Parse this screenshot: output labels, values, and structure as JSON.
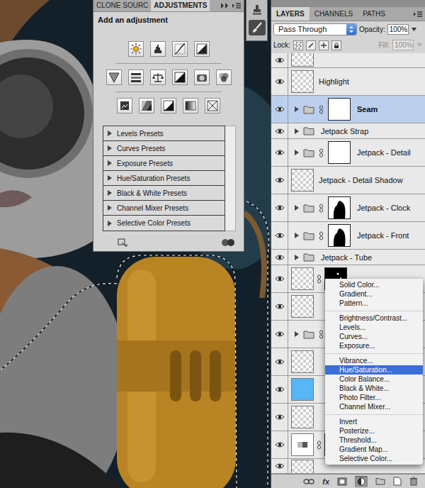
{
  "adjustments_panel": {
    "tabs": [
      {
        "label": "CLONE SOURC",
        "selected": false
      },
      {
        "label": "ADJUSTMENTS",
        "selected": true
      }
    ],
    "heading": "Add an adjustment",
    "presets": [
      {
        "label": "Levels Presets",
        "expanded": false
      },
      {
        "label": "Curves Presets",
        "expanded": false
      },
      {
        "label": "Exposure Presets",
        "expanded": false
      },
      {
        "label": "Hue/Saturation Presets",
        "expanded": false
      },
      {
        "label": "Black & White Presets",
        "expanded": false
      },
      {
        "label": "Channel Mixer Presets",
        "expanded": false
      },
      {
        "label": "Selective Color Presets",
        "expanded": false
      }
    ]
  },
  "layers_panel": {
    "tabs": [
      {
        "label": "LAYERS",
        "selected": true
      },
      {
        "label": "CHANNELS",
        "selected": false
      },
      {
        "label": "PATHS",
        "selected": false
      }
    ],
    "blend_mode": "Pass Through",
    "opacity_label": "Opacity:",
    "opacity": "100%",
    "lock_label": "Lock:",
    "fill_label": "Fill:",
    "fill": "100%",
    "fill_disabled": true,
    "layers": [
      {
        "name": "",
        "kind": "layer",
        "visible": true,
        "selected": false,
        "expanded": false,
        "mask": "none",
        "partial": true,
        "color": ""
      },
      {
        "name": "Highlight",
        "kind": "layer",
        "visible": true,
        "selected": false,
        "expanded": false,
        "mask": "none",
        "partial": false,
        "color": ""
      },
      {
        "name": "Seam",
        "kind": "group",
        "visible": true,
        "selected": true,
        "expanded": false,
        "mask": "white",
        "partial": false,
        "color": ""
      },
      {
        "name": "Jetpack Strap",
        "kind": "group",
        "visible": true,
        "selected": false,
        "expanded": false,
        "mask": "none",
        "partial": false,
        "color": ""
      },
      {
        "name": "Jetpack - Detail",
        "kind": "group",
        "visible": true,
        "selected": false,
        "expanded": false,
        "mask": "white",
        "partial": false,
        "color": ""
      },
      {
        "name": "Jetpack - Detail Shadow",
        "kind": "layer",
        "visible": true,
        "selected": false,
        "expanded": false,
        "mask": "none",
        "partial": false,
        "color": ""
      },
      {
        "name": "Jetpack - Clock",
        "kind": "group",
        "visible": true,
        "selected": false,
        "expanded": false,
        "mask": "shape",
        "partial": false,
        "color": ""
      },
      {
        "name": "Jetpack - Front",
        "kind": "group",
        "visible": true,
        "selected": false,
        "expanded": false,
        "mask": "shape",
        "partial": false,
        "color": ""
      },
      {
        "name": "Jetpack - Tube",
        "kind": "group",
        "visible": true,
        "selected": false,
        "expanded": false,
        "mask": "none",
        "partial": false,
        "color": ""
      },
      {
        "name": "",
        "kind": "layer",
        "visible": true,
        "selected": false,
        "expanded": false,
        "mask": "dark",
        "partial": false,
        "color": ""
      },
      {
        "name": "",
        "kind": "layer",
        "visible": true,
        "selected": false,
        "expanded": false,
        "mask": "none",
        "partial": false,
        "color": ""
      },
      {
        "name": "",
        "kind": "group",
        "visible": true,
        "selected": false,
        "expanded": false,
        "mask": "white",
        "partial": false,
        "color": ""
      },
      {
        "name": "",
        "kind": "layer",
        "visible": true,
        "selected": false,
        "expanded": false,
        "mask": "none",
        "partial": false,
        "color": ""
      },
      {
        "name": "",
        "kind": "fill",
        "visible": true,
        "selected": false,
        "expanded": false,
        "mask": "none",
        "partial": false,
        "color": "#56b6f6"
      },
      {
        "name": "",
        "kind": "layer",
        "visible": true,
        "selected": false,
        "expanded": false,
        "mask": "none",
        "partial": false,
        "color": ""
      },
      {
        "name": "",
        "kind": "adjustment",
        "visible": true,
        "selected": false,
        "expanded": false,
        "mask": "white",
        "partial": false,
        "color": ""
      },
      {
        "name": "",
        "kind": "layer",
        "visible": true,
        "selected": false,
        "expanded": false,
        "mask": "none",
        "partial": true,
        "color": ""
      }
    ]
  },
  "context_menu": {
    "groups": [
      [
        {
          "label": "Solid Color...",
          "selected": false
        },
        {
          "label": "Gradient...",
          "selected": false
        },
        {
          "label": "Pattern...",
          "selected": false
        }
      ],
      [
        {
          "label": "Brightness/Contrast...",
          "selected": false
        },
        {
          "label": "Levels...",
          "selected": false
        },
        {
          "label": "Curves...",
          "selected": false
        },
        {
          "label": "Exposure...",
          "selected": false
        }
      ],
      [
        {
          "label": "Vibrance...",
          "selected": false
        },
        {
          "label": "Hue/Saturation...",
          "selected": true
        },
        {
          "label": "Color Balance...",
          "selected": false
        },
        {
          "label": "Black & White...",
          "selected": false
        },
        {
          "label": "Photo Filter...",
          "selected": false
        },
        {
          "label": "Channel Mixer...",
          "selected": false
        }
      ],
      [
        {
          "label": "Invert",
          "selected": false
        },
        {
          "label": "Posterize...",
          "selected": false
        },
        {
          "label": "Threshold...",
          "selected": false
        },
        {
          "label": "Gradient Map...",
          "selected": false
        },
        {
          "label": "Selective Color...",
          "selected": false
        }
      ]
    ]
  },
  "bottom_bar": {
    "fx": "fx",
    "adjustment_pressed": true
  }
}
